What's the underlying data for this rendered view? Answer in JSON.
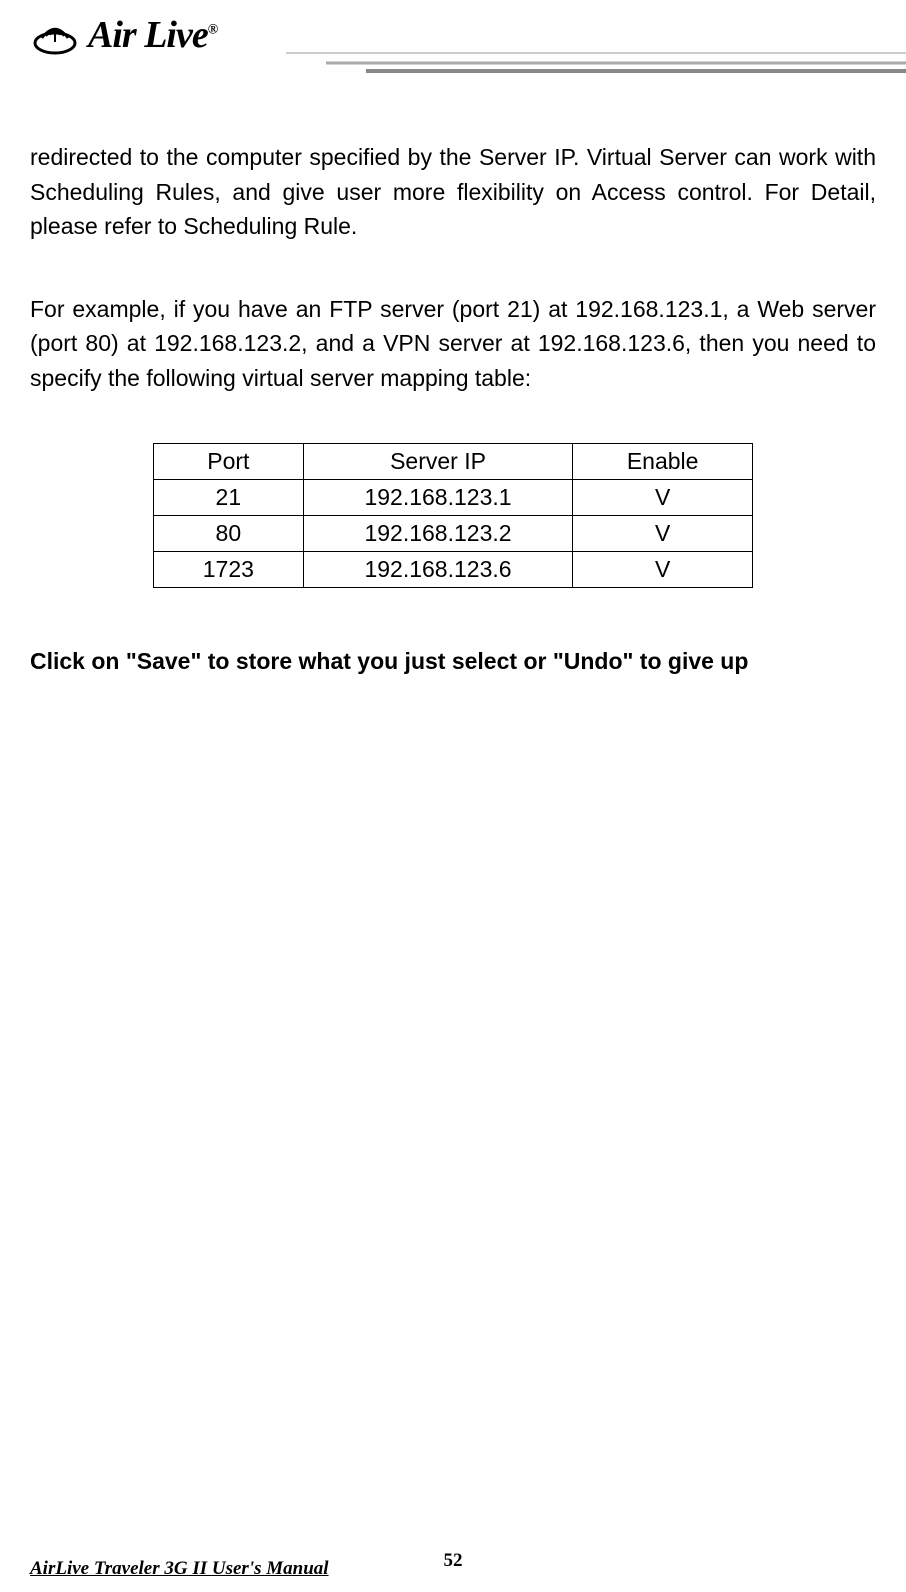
{
  "header": {
    "brand": "Air Live",
    "trademark": "®"
  },
  "paragraphs": {
    "p1": "redirected to the computer specified by the Server IP. Virtual Server can work with Scheduling Rules, and give user more flexibility on Access control. For Detail, please refer to Scheduling Rule.",
    "p2": "For example, if you have an FTP server (port 21) at 192.168.123.1, a Web server (port 80) at 192.168.123.2, and a VPN server at 192.168.123.6, then you need to specify the following virtual server mapping table:"
  },
  "table": {
    "headers": {
      "port": "Port",
      "server_ip": "Server IP",
      "enable": "Enable"
    },
    "rows": [
      {
        "port": "21",
        "server_ip": "192.168.123.1",
        "enable": "V"
      },
      {
        "port": "80",
        "server_ip": "192.168.123.2",
        "enable": "V"
      },
      {
        "port": "1723",
        "server_ip": "192.168.123.6",
        "enable": "V"
      }
    ]
  },
  "instruction": "Click on \"Save\" to store what you just select or \"Undo\" to give up",
  "footer": {
    "title": "AirLive Traveler 3G II User's Manual",
    "page": "52"
  }
}
